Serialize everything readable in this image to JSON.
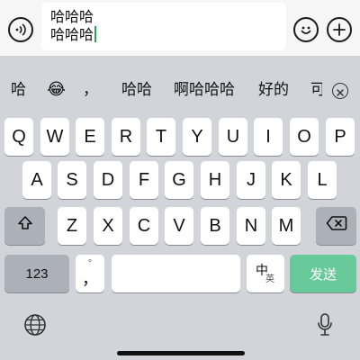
{
  "input": {
    "text_line1": "哈哈哈",
    "text_line2": "哈哈哈"
  },
  "candidates": {
    "items": [
      "哈",
      "😂",
      "，",
      "哈哈",
      "啊哈哈哈",
      "好的",
      "可"
    ]
  },
  "keyboard": {
    "row1": [
      "Q",
      "W",
      "E",
      "R",
      "T",
      "Y",
      "U",
      "I",
      "O",
      "P"
    ],
    "row2": [
      "A",
      "S",
      "D",
      "F",
      "G",
      "H",
      "J",
      "K",
      "L"
    ],
    "row3": [
      "Z",
      "X",
      "C",
      "V",
      "B",
      "N",
      "M"
    ],
    "numbers_label": "123",
    "comma_top": "°",
    "comma_label": "，",
    "lang_zh": "中",
    "lang_en": "英",
    "send_label": "发送"
  },
  "colors": {
    "send": "#68c99a",
    "keyboard_bg": "#d3d4d9",
    "caret": "#2e9e5b"
  },
  "icons": {
    "voice": "voice-wave-icon",
    "emoji": "emoji-smile-icon",
    "plus": "plus-icon",
    "shift": "shift-icon",
    "backspace": "backspace-icon",
    "globe": "globe-icon",
    "mic": "microphone-icon",
    "close": "close-icon"
  }
}
